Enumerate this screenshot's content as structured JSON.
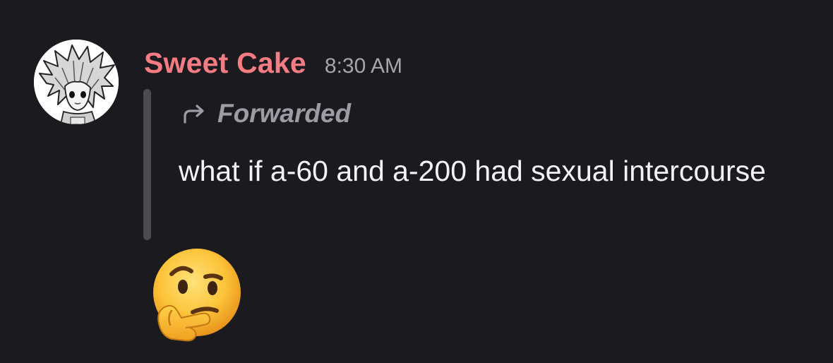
{
  "message": {
    "author": {
      "name": "Sweet Cake",
      "name_color": "#f47c82",
      "avatar_icon": "anime-spiky-hair-avatar-icon"
    },
    "timestamp": "8:30 AM",
    "forward": {
      "label": "Forwarded",
      "icon": "forward-arrow-icon",
      "bar_color": "#4b4c53"
    },
    "content": "what if a-60 and a-200 had sexual intercourse",
    "reaction_emoji": {
      "glyph": "🤔",
      "icon": "thinking-face-emoji-icon"
    }
  },
  "theme": {
    "background": "#1b1a1f",
    "text": "#f2f3f5",
    "muted": "#a4a6ad"
  }
}
